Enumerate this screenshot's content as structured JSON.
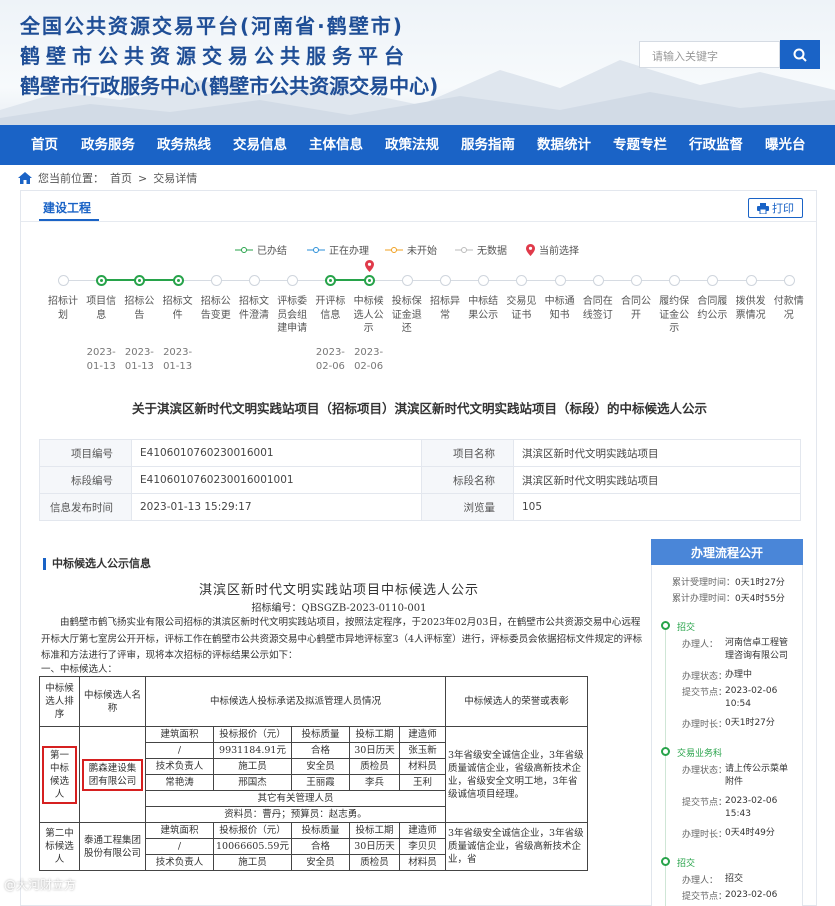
{
  "header": {
    "title_line1": "全国公共资源交易平台(河南省·鹤壁市)",
    "title_line2": "鹤壁市公共资源交易公共服务平台",
    "title_line3": "鹤壁市行政服务中心(鹤壁市公共资源交易中心)",
    "search_placeholder": "请输入关键字"
  },
  "nav": [
    "首页",
    "政务服务",
    "政务热线",
    "交易信息",
    "主体信息",
    "政策法规",
    "服务指南",
    "数据统计",
    "专题专栏",
    "行政监督",
    "曝光台"
  ],
  "breadcrumb": {
    "prefix": "您当前位置：",
    "home": "首页",
    "sep": ">",
    "current": "交易详情"
  },
  "tab": "建设工程",
  "print_label": "打印",
  "legend": [
    {
      "label": "已办结",
      "color": "#27a34a"
    },
    {
      "label": "正在办理",
      "color": "#2b8fd8"
    },
    {
      "label": "未开始",
      "color": "#f0a020"
    },
    {
      "label": "无数据",
      "color": "#bbbbbb"
    },
    {
      "label": "当前选择",
      "color": "#e03a4a"
    }
  ],
  "steps": [
    {
      "label": "招标计划",
      "status": "none",
      "date": ""
    },
    {
      "label": "项目信息",
      "status": "done",
      "date": "2023-01-13"
    },
    {
      "label": "招标公告",
      "status": "done",
      "date": "2023-01-13"
    },
    {
      "label": "招标文件",
      "status": "done",
      "date": "2023-01-13"
    },
    {
      "label": "招标公告变更",
      "status": "none",
      "date": ""
    },
    {
      "label": "招标文件澄清",
      "status": "none",
      "date": ""
    },
    {
      "label": "评标委员会组建申请",
      "status": "none",
      "date": ""
    },
    {
      "label": "开评标信息",
      "status": "done",
      "date": "2023-02-06"
    },
    {
      "label": "中标候选人公示",
      "status": "done",
      "date": "2023-02-06"
    },
    {
      "label": "投标保证金退还",
      "status": "none",
      "date": ""
    },
    {
      "label": "招标异常",
      "status": "none",
      "date": ""
    },
    {
      "label": "中标结果公示",
      "status": "none",
      "date": ""
    },
    {
      "label": "交易见证书",
      "status": "none",
      "date": ""
    },
    {
      "label": "中标通知书",
      "status": "none",
      "date": ""
    },
    {
      "label": "合同在线签订",
      "status": "none",
      "date": ""
    },
    {
      "label": "合同公开",
      "status": "none",
      "date": ""
    },
    {
      "label": "履约保证金公示",
      "status": "none",
      "date": ""
    },
    {
      "label": "合同履约公示",
      "status": "none",
      "date": ""
    },
    {
      "label": "拨供发票情况",
      "status": "none",
      "date": ""
    },
    {
      "label": "付款情况",
      "status": "none",
      "date": ""
    }
  ],
  "doc_title": "关于淇滨区新时代文明实践站项目（招标项目）淇滨区新时代文明实践站项目（标段）的中标候选人公示",
  "info": {
    "project_no_label": "项目编号",
    "project_no": "E4106010760230016001",
    "project_name_label": "项目名称",
    "project_name": "淇滨区新时代文明实践站项目",
    "section_no_label": "标段编号",
    "section_no": "E4106010760230016001001",
    "section_name_label": "标段名称",
    "section_name": "淇滨区新时代文明实践站项目",
    "publish_time_label": "信息发布时间",
    "publish_time": "2023-01-13 15:29:17",
    "views_label": "浏览量",
    "views": "105"
  },
  "section_title": "中标候选人公示信息",
  "notice": {
    "title": "淇滨区新时代文明实践站项目中标候选人公示",
    "code": "招标编号：QBSGZB-2023-0110-001",
    "para": "由鹤壁市鹤飞扬实业有限公司招标的淇滨区新时代文明实践站项目，按照法定程序，于2023年02月03日，在鹤壁市公共资源交易中心远程开标大厅第七室房公开开标，评标工作在鹤壁市公共资源交易中心鹤壁市异地评标室3（4人评标室）进行，评标委员会依据招标文件规定的评标标准和方法进行了评审，现将本次招标的评标结果公示如下：",
    "sub": "一、中标候选人：",
    "table": {
      "h_rank": "中标候选人排序",
      "h_name": "中标候选人名称",
      "h_commit": "中标候选人投标承诺及拟派管理人员情况",
      "h_awards": "中标候选人的荣誉或表彰",
      "sub_headers": [
        "建筑面积",
        "投标报价（元）",
        "投标质量",
        "投标工期",
        "建造师"
      ],
      "sub_headers2": [
        "技术负责人",
        "施工员",
        "安全员",
        "质检员",
        "材料员"
      ],
      "other_label": "其它有关管理人员",
      "c1": {
        "rank": "第一中标候选人",
        "name": "鹏森建设集团有限公司",
        "area": "/",
        "price": "9931184.91元",
        "quality": "合格",
        "period": "30日历天",
        "builder": "张玉新",
        "tech": "常艳涛",
        "worker": "邢国杰",
        "safety": "王丽霞",
        "inspector": "李兵",
        "material": "王利",
        "others": "资料员：曹丹；预算员：赵志勇。",
        "awards": "3年省级安全诚信企业，3年省级质量诚信企业，省级高新技术企业，省级安全文明工地，3年省级诚信项目经理。"
      },
      "c2": {
        "rank": "第二中标候选人",
        "name": "泰通工程集团股份有限公司",
        "area": "/",
        "price": "10066605.59元",
        "quality": "合格",
        "period": "30日历天",
        "builder": "李贝贝",
        "awards": "3年省级安全诚信企业，3年省级质量诚信企业，省级高新技术企业，省"
      }
    }
  },
  "side": {
    "title": "办理流程公开",
    "total_time_label": "累计受理时间：",
    "total_time": "0天1时27分",
    "total_handle_label": "累计办理时间：",
    "total_handle": "0天4时55分",
    "nodes": [
      {
        "name": "招交",
        "rows": [
          [
            "办理人：",
            "河南信卓工程管理咨询有限公司"
          ],
          [
            "办理状态：",
            "办理中"
          ],
          [
            "提交节点：",
            "2023-02-06 10:54"
          ],
          [
            "办理时长：",
            "0天1时27分"
          ]
        ]
      },
      {
        "name": "交易业务科",
        "rows": [
          [
            "办理状态：",
            "请上传公示菜单附件"
          ],
          [
            "提交节点：",
            "2023-02-06 15:43"
          ],
          [
            "办理时长：",
            "0天4时49分"
          ]
        ]
      },
      {
        "name": "招交",
        "rows": [
          [
            "办理人：",
            "招交"
          ],
          [
            "提交节点：",
            "2023-02-06"
          ]
        ]
      }
    ]
  },
  "watermark": "@大河财立方"
}
